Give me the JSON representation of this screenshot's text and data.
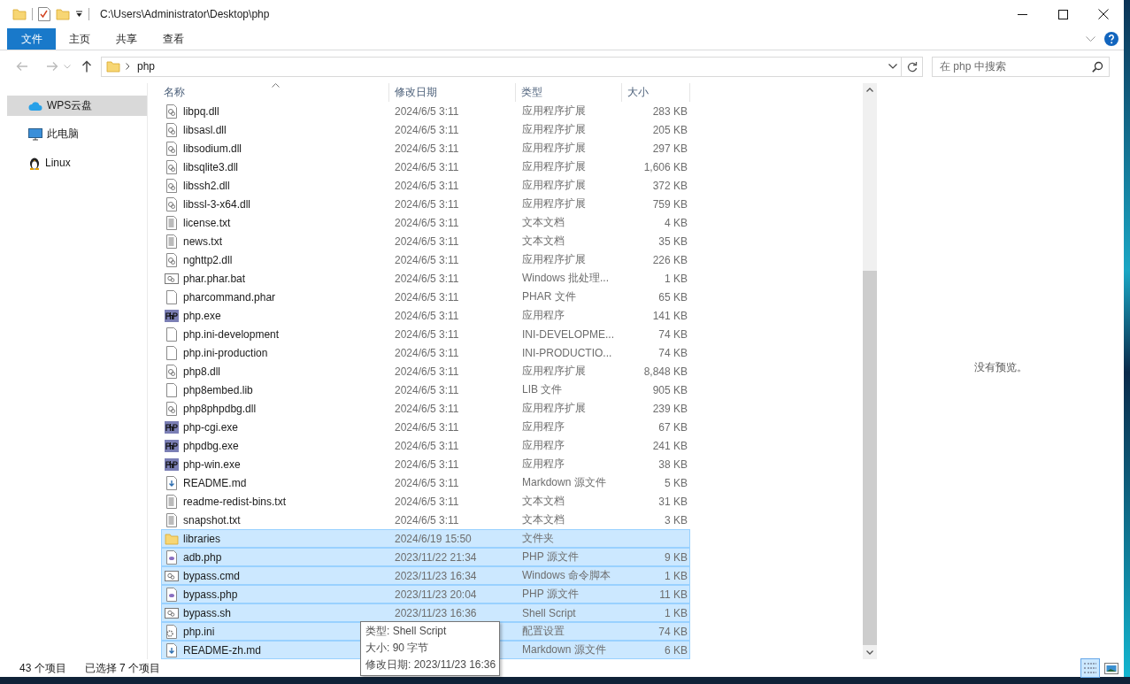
{
  "window": {
    "title": "C:\\Users\\Administrator\\Desktop\\php"
  },
  "ribbon_tabs": [
    {
      "label": "文件",
      "kind": "file"
    },
    {
      "label": "主页",
      "kind": "tab"
    },
    {
      "label": "共享",
      "kind": "tab"
    },
    {
      "label": "查看",
      "kind": "tab"
    }
  ],
  "address": {
    "crumbs": [
      "php"
    ]
  },
  "search": {
    "placeholder": "在 php 中搜索"
  },
  "sidebar": {
    "items": [
      {
        "label": "WPS云盘",
        "kind": "cloud",
        "selected": true
      },
      {
        "label": "此电脑",
        "kind": "pc",
        "selected": false
      },
      {
        "label": "Linux",
        "kind": "linux",
        "selected": false
      }
    ]
  },
  "table": {
    "columns": [
      {
        "label": "名称",
        "sorted": true
      },
      {
        "label": "修改日期",
        "sorted": false
      },
      {
        "label": "类型",
        "sorted": false
      },
      {
        "label": "大小",
        "sorted": false
      }
    ],
    "rows": [
      {
        "name": "libpq.dll",
        "kind": "dll",
        "date": "2024/6/5 3:11",
        "type": "应用程序扩展",
        "size": "283 KB",
        "selected": false
      },
      {
        "name": "libsasl.dll",
        "kind": "dll",
        "date": "2024/6/5 3:11",
        "type": "应用程序扩展",
        "size": "205 KB",
        "selected": false
      },
      {
        "name": "libsodium.dll",
        "kind": "dll",
        "date": "2024/6/5 3:11",
        "type": "应用程序扩展",
        "size": "297 KB",
        "selected": false
      },
      {
        "name": "libsqlite3.dll",
        "kind": "dll",
        "date": "2024/6/5 3:11",
        "type": "应用程序扩展",
        "size": "1,606 KB",
        "selected": false
      },
      {
        "name": "libssh2.dll",
        "kind": "dll",
        "date": "2024/6/5 3:11",
        "type": "应用程序扩展",
        "size": "372 KB",
        "selected": false
      },
      {
        "name": "libssl-3-x64.dll",
        "kind": "dll",
        "date": "2024/6/5 3:11",
        "type": "应用程序扩展",
        "size": "759 KB",
        "selected": false
      },
      {
        "name": "license.txt",
        "kind": "txt",
        "date": "2024/6/5 3:11",
        "type": "文本文档",
        "size": "4 KB",
        "selected": false
      },
      {
        "name": "news.txt",
        "kind": "txt",
        "date": "2024/6/5 3:11",
        "type": "文本文档",
        "size": "35 KB",
        "selected": false
      },
      {
        "name": "nghttp2.dll",
        "kind": "dll",
        "date": "2024/6/5 3:11",
        "type": "应用程序扩展",
        "size": "226 KB",
        "selected": false
      },
      {
        "name": "phar.phar.bat",
        "kind": "script",
        "date": "2024/6/5 3:11",
        "type": "Windows 批处理...",
        "size": "1 KB",
        "selected": false
      },
      {
        "name": "pharcommand.phar",
        "kind": "blank",
        "date": "2024/6/5 3:11",
        "type": "PHAR 文件",
        "size": "65 KB",
        "selected": false
      },
      {
        "name": "php.exe",
        "kind": "exe",
        "date": "2024/6/5 3:11",
        "type": "应用程序",
        "size": "141 KB",
        "selected": false
      },
      {
        "name": "php.ini-development",
        "kind": "blank",
        "date": "2024/6/5 3:11",
        "type": "INI-DEVELOPME...",
        "size": "74 KB",
        "selected": false
      },
      {
        "name": "php.ini-production",
        "kind": "blank",
        "date": "2024/6/5 3:11",
        "type": "INI-PRODUCTIO...",
        "size": "74 KB",
        "selected": false
      },
      {
        "name": "php8.dll",
        "kind": "dll",
        "date": "2024/6/5 3:11",
        "type": "应用程序扩展",
        "size": "8,848 KB",
        "selected": false
      },
      {
        "name": "php8embed.lib",
        "kind": "blank",
        "date": "2024/6/5 3:11",
        "type": "LIB 文件",
        "size": "905 KB",
        "selected": false
      },
      {
        "name": "php8phpdbg.dll",
        "kind": "dll",
        "date": "2024/6/5 3:11",
        "type": "应用程序扩展",
        "size": "239 KB",
        "selected": false
      },
      {
        "name": "php-cgi.exe",
        "kind": "exe",
        "date": "2024/6/5 3:11",
        "type": "应用程序",
        "size": "67 KB",
        "selected": false
      },
      {
        "name": "phpdbg.exe",
        "kind": "exe",
        "date": "2024/6/5 3:11",
        "type": "应用程序",
        "size": "241 KB",
        "selected": false
      },
      {
        "name": "php-win.exe",
        "kind": "exe",
        "date": "2024/6/5 3:11",
        "type": "应用程序",
        "size": "38 KB",
        "selected": false
      },
      {
        "name": "README.md",
        "kind": "md",
        "date": "2024/6/5 3:11",
        "type": "Markdown 源文件",
        "size": "5 KB",
        "selected": false
      },
      {
        "name": "readme-redist-bins.txt",
        "kind": "txt",
        "date": "2024/6/5 3:11",
        "type": "文本文档",
        "size": "31 KB",
        "selected": false
      },
      {
        "name": "snapshot.txt",
        "kind": "txt",
        "date": "2024/6/5 3:11",
        "type": "文本文档",
        "size": "3 KB",
        "selected": false
      },
      {
        "name": "libraries",
        "kind": "folder",
        "date": "2024/6/19 15:50",
        "type": "文件夹",
        "selected": true
      },
      {
        "name": "adb.php",
        "kind": "php",
        "date": "2023/11/22 21:34",
        "type": "PHP 源文件",
        "size": "9 KB",
        "selected": true
      },
      {
        "name": "bypass.cmd",
        "kind": "script",
        "date": "2023/11/23 16:34",
        "type": "Windows 命令脚本",
        "size": "1 KB",
        "selected": true
      },
      {
        "name": "bypass.php",
        "kind": "php",
        "date": "2023/11/23 20:04",
        "type": "PHP 源文件",
        "size": "11 KB",
        "selected": true
      },
      {
        "name": "bypass.sh",
        "kind": "script",
        "date": "2023/11/23 16:36",
        "type": "Shell Script",
        "size": "1 KB",
        "selected": true
      },
      {
        "name": "php.ini",
        "kind": "config",
        "type": "配置设置",
        "size": "74 KB",
        "selected": true
      },
      {
        "name": "README-zh.md",
        "kind": "md",
        "type": "Markdown 源文件",
        "size": "6 KB",
        "selected": true
      }
    ]
  },
  "preview": {
    "message": "没有预览。"
  },
  "tooltip": {
    "lines": [
      "类型: Shell Script",
      "大小: 90 字节",
      "修改日期: 2023/11/23 16:36"
    ]
  },
  "status_bar": {
    "item_count": "43 个项目",
    "selection": "已选择 7 个项目"
  },
  "view_buttons": [
    {
      "kind": "details",
      "selected": true
    },
    {
      "kind": "large-icons",
      "selected": false
    }
  ]
}
